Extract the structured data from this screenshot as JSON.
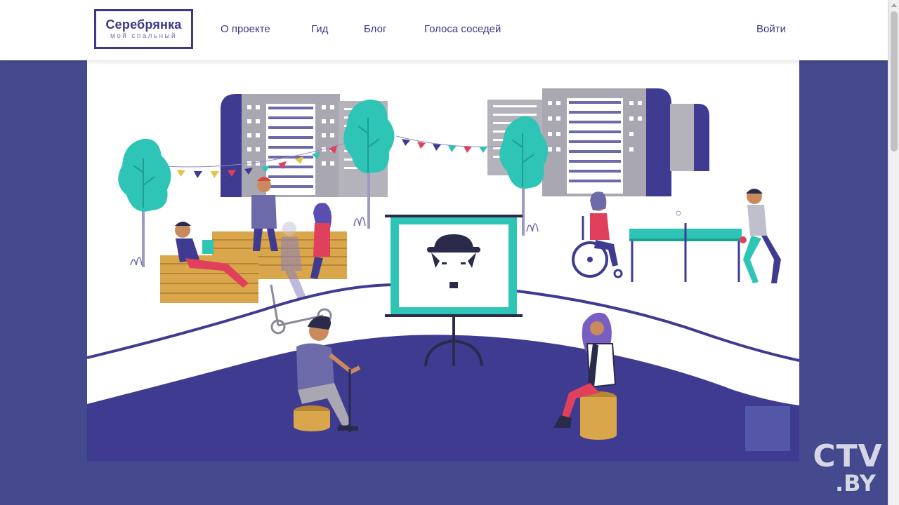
{
  "header": {
    "logo_title": "Серебрянка",
    "logo_subtitle": "мой спальный",
    "nav": [
      "О проекте",
      "Гид",
      "Блог",
      "Голоса соседей"
    ],
    "login": "Войти"
  },
  "hero": {
    "illustration": "neighborhood-yard-scene",
    "colors": {
      "primary": "#3f3b91",
      "teal": "#2ec4b6",
      "building": "#a9a8b2",
      "wood": "#d9a64c"
    }
  },
  "watermark": {
    "main": "CTV",
    "sub": ".BY"
  }
}
